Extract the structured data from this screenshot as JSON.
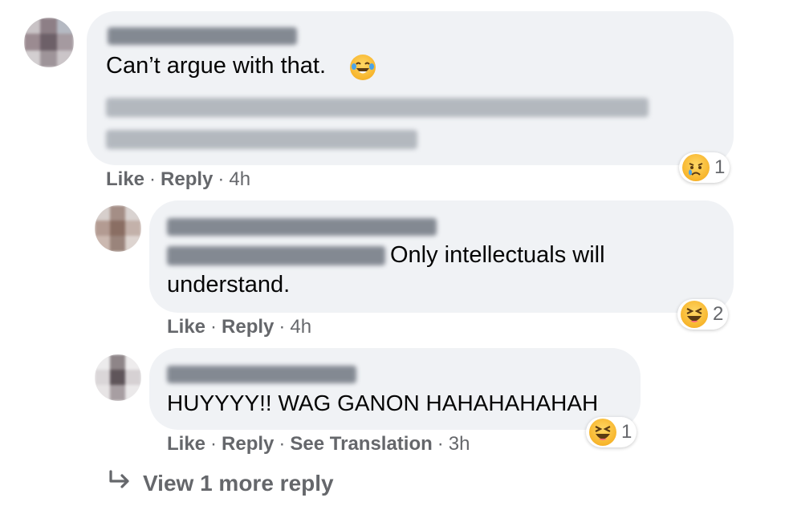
{
  "comments": [
    {
      "text": "Can’t argue with that.",
      "actions": {
        "like": "Like",
        "reply": "Reply",
        "time": "4h"
      },
      "reaction": {
        "icon": "crying-face-icon",
        "count": "1"
      }
    },
    {
      "text": "Only intellectuals will understand.",
      "text_line1": "Only intellectuals will",
      "text_line2": "understand.",
      "actions": {
        "like": "Like",
        "reply": "Reply",
        "time": "4h"
      },
      "reaction": {
        "icon": "laughing-squint-icon",
        "count": "2"
      }
    },
    {
      "text": "HUYYYY!! WAG GANON HAHAHAHAHAH",
      "actions": {
        "like": "Like",
        "reply": "Reply",
        "see_translation": "See Translation",
        "time": "3h"
      },
      "reaction": {
        "icon": "laughing-squint-icon",
        "count": "1"
      }
    }
  ],
  "view_more": {
    "icon": "reply-arrow-icon",
    "label": "View 1 more reply"
  },
  "colors": {
    "bubble": "#f0f2f5",
    "meta": "#65676b",
    "text": "#050505",
    "emoji": "#f7b52c"
  }
}
